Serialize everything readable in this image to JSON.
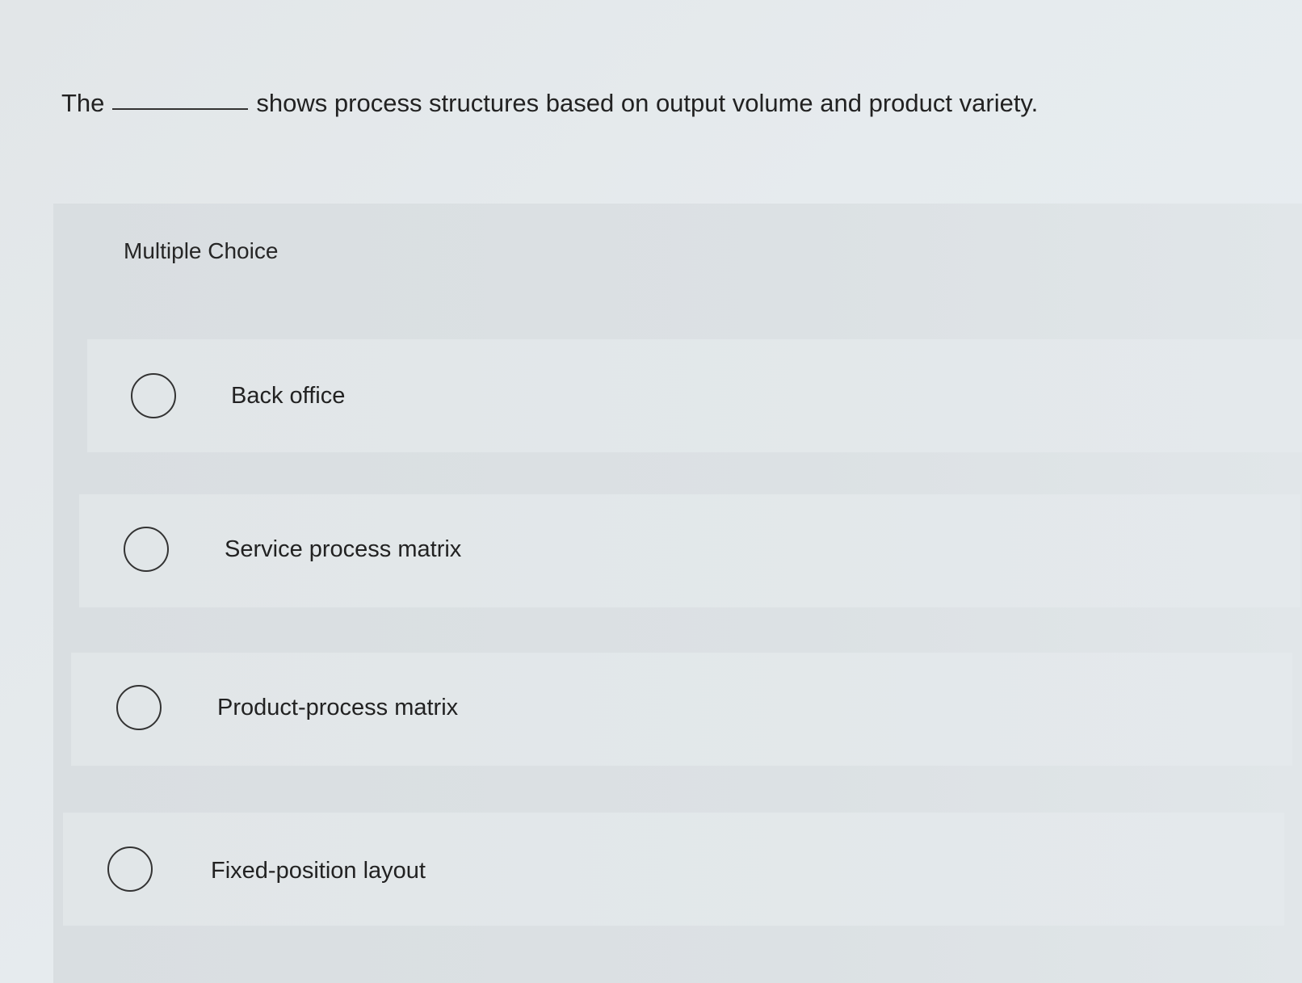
{
  "question": {
    "prefix": "The",
    "suffix": "shows process structures based on output volume and product variety."
  },
  "multiple_choice": {
    "heading": "Multiple Choice",
    "options": [
      {
        "label": "Back office"
      },
      {
        "label": "Service process matrix"
      },
      {
        "label": "Product-process matrix"
      },
      {
        "label": "Fixed-position layout"
      }
    ]
  }
}
